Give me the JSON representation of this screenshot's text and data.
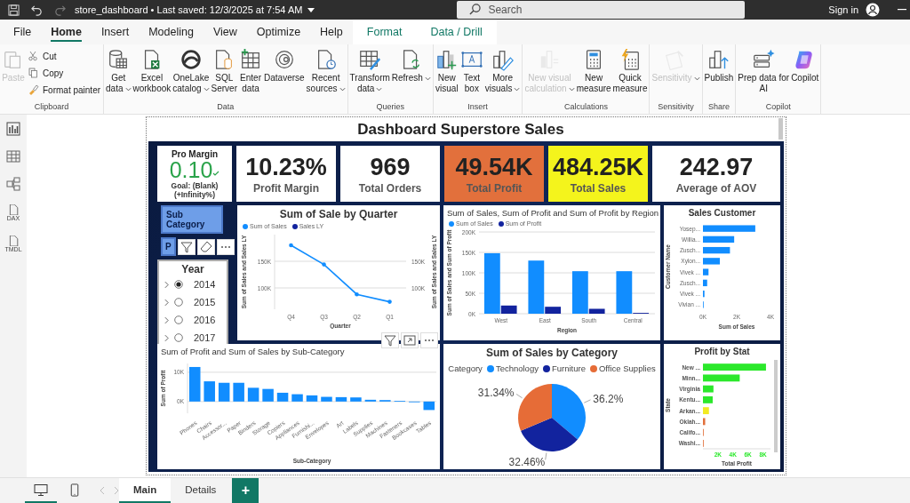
{
  "title_bar": {
    "title": "store_dashboard • Last saved: 12/3/2025 at 7:54 AM",
    "search_placeholder": "Search",
    "sign_in": "Sign in"
  },
  "menu_tabs": [
    {
      "label": "File",
      "selected": false,
      "kind": "standard"
    },
    {
      "label": "Home",
      "selected": true,
      "kind": "standard"
    },
    {
      "label": "Insert",
      "selected": false,
      "kind": "standard"
    },
    {
      "label": "Modeling",
      "selected": false,
      "kind": "standard"
    },
    {
      "label": "View",
      "selected": false,
      "kind": "standard"
    },
    {
      "label": "Optimize",
      "selected": false,
      "kind": "standard"
    },
    {
      "label": "Help",
      "selected": false,
      "kind": "standard"
    },
    {
      "label": "Format",
      "selected": false,
      "kind": "contextual"
    },
    {
      "label": "Data / Drill",
      "selected": false,
      "kind": "contextual"
    }
  ],
  "ribbon": {
    "groups": [
      {
        "label": "Clipboard",
        "buttons": [
          {
            "kind": "large",
            "lines": [
              "Paste"
            ],
            "disabled": true,
            "dropdown": false
          },
          {
            "kind": "small",
            "lines": [
              "Cut"
            ],
            "disabled": false,
            "dropdown": false
          },
          {
            "kind": "small",
            "lines": [
              "Copy"
            ],
            "disabled": false,
            "dropdown": false
          },
          {
            "kind": "small",
            "lines": [
              "Format painter"
            ],
            "disabled": false,
            "dropdown": false
          }
        ]
      },
      {
        "label": "Data",
        "buttons": [
          {
            "kind": "large",
            "lines": [
              "Get",
              "data"
            ],
            "disabled": false,
            "dropdown": true
          },
          {
            "kind": "large",
            "lines": [
              "Excel",
              "workbook"
            ],
            "disabled": false,
            "dropdown": false
          },
          {
            "kind": "large",
            "lines": [
              "OneLake",
              "catalog"
            ],
            "disabled": false,
            "dropdown": true
          },
          {
            "kind": "large",
            "lines": [
              "SQL",
              "Server"
            ],
            "disabled": false,
            "dropdown": false
          },
          {
            "kind": "large",
            "lines": [
              "Enter",
              "data"
            ],
            "disabled": false,
            "dropdown": false
          },
          {
            "kind": "large",
            "lines": [
              "Dataverse"
            ],
            "disabled": false,
            "dropdown": false
          },
          {
            "kind": "large",
            "lines": [
              "Recent",
              "sources"
            ],
            "disabled": false,
            "dropdown": true
          }
        ]
      },
      {
        "label": "Queries",
        "buttons": [
          {
            "kind": "large",
            "lines": [
              "Transform",
              "data"
            ],
            "disabled": false,
            "dropdown": true
          },
          {
            "kind": "large",
            "lines": [
              "Refresh"
            ],
            "disabled": false,
            "dropdown": true
          }
        ]
      },
      {
        "label": "Insert",
        "buttons": [
          {
            "kind": "large",
            "lines": [
              "New",
              "visual"
            ],
            "disabled": false,
            "dropdown": false
          },
          {
            "kind": "large",
            "lines": [
              "Text",
              "box"
            ],
            "disabled": false,
            "dropdown": false
          },
          {
            "kind": "large",
            "lines": [
              "More",
              "visuals"
            ],
            "disabled": false,
            "dropdown": true
          }
        ]
      },
      {
        "label": "Calculations",
        "buttons": [
          {
            "kind": "large",
            "lines": [
              "New visual",
              "calculation"
            ],
            "disabled": true,
            "dropdown": true
          },
          {
            "kind": "large",
            "lines": [
              "New",
              "measure"
            ],
            "disabled": false,
            "dropdown": false
          },
          {
            "kind": "large",
            "lines": [
              "Quick",
              "measure"
            ],
            "disabled": false,
            "dropdown": false
          }
        ]
      },
      {
        "label": "Sensitivity",
        "buttons": [
          {
            "kind": "large",
            "lines": [
              "Sensitivity"
            ],
            "disabled": true,
            "dropdown": true
          }
        ]
      },
      {
        "label": "Share",
        "buttons": [
          {
            "kind": "large",
            "lines": [
              "Publish"
            ],
            "disabled": false,
            "dropdown": false
          }
        ]
      },
      {
        "label": "Copilot",
        "buttons": [
          {
            "kind": "large",
            "lines": [
              "Prep data for",
              "AI"
            ],
            "disabled": false,
            "dropdown": false
          },
          {
            "kind": "large",
            "lines": [
              "Copilot"
            ],
            "disabled": false,
            "dropdown": false
          }
        ]
      }
    ]
  },
  "side_rail": [
    {
      "kind": "report"
    },
    {
      "kind": "table"
    },
    {
      "kind": "model"
    },
    {
      "kind": "dax",
      "label": "DAX"
    },
    {
      "kind": "tmdl",
      "label": "TMDL"
    }
  ],
  "report": {
    "title": "Dashboard Superstore Sales",
    "goal_card": {
      "title": "Pro Margin",
      "value": "0.10",
      "goal": "Goal: (Blank)",
      "change": "(+Infinity%)"
    },
    "kpi_cards": [
      {
        "value": "10.23%",
        "label": "Profit Margin",
        "color": "#ffffff"
      },
      {
        "value": "969",
        "label": "Total Orders",
        "color": "#ffffff"
      },
      {
        "value": "49.54K",
        "label": "Total Profit",
        "color": "#e2703c"
      },
      {
        "value": "484.25K",
        "label": "Total Sales",
        "color": "#f4f41c"
      },
      {
        "value": "242.97",
        "label": "Average of AOV",
        "color": "#ffffff"
      }
    ],
    "buttons": [
      {
        "label": "Sub Category"
      },
      {
        "label": "P"
      }
    ],
    "year_slicer": {
      "title": "Year",
      "items": [
        {
          "label": "2014",
          "selected": true
        },
        {
          "label": "2015",
          "selected": false
        },
        {
          "label": "2016",
          "selected": false
        },
        {
          "label": "2017",
          "selected": false
        }
      ]
    },
    "line_chart": {
      "chart_data": {
        "type": "line",
        "title": "Sum of Sale by Quarter",
        "xlabel": "Quarter",
        "ylabel": "Sum of Sales and Sales LY",
        "y2label": "Sum of Sales and Sales LY",
        "categories": [
          "Q4",
          "Q3",
          "Q2",
          "Q1"
        ],
        "ylim": [
          60000,
          200000
        ],
        "grid": true,
        "legend": "top",
        "yticks": [
          {
            "value": 100000,
            "label": "100K"
          },
          {
            "value": 150000,
            "label": "150K"
          }
        ],
        "series": [
          {
            "name": "Sum of Sales",
            "color": "#118dff",
            "values": [
              180000,
              144000,
              88000,
              74000
            ]
          },
          {
            "name": "Sales LY",
            "color": "#12239e",
            "values": [
              null,
              null,
              null,
              null
            ]
          }
        ]
      }
    },
    "region_chart": {
      "chart_data": {
        "type": "bar",
        "title": "Sum of Sales, Sum of Profit and Sum of Profit by Region",
        "xlabel": "Region",
        "ylabel": "Sum of Sales and Sum of Profit",
        "categories": [
          "West",
          "East",
          "South",
          "Central"
        ],
        "ylim": [
          0,
          200000
        ],
        "grid": true,
        "legend": "top",
        "yticks": [
          {
            "value": 0,
            "label": "0K"
          },
          {
            "value": 50000,
            "label": "50K"
          },
          {
            "value": 100000,
            "label": "100K"
          },
          {
            "value": 150000,
            "label": "150K"
          },
          {
            "value": 200000,
            "label": "200K"
          }
        ],
        "series": [
          {
            "name": "Sum of Sales",
            "color": "#118dff",
            "values": [
              148000,
              130000,
              104000,
              104000
            ]
          },
          {
            "name": "Sum of Profit",
            "color": "#12239e",
            "values": [
              20000,
              17000,
              12000,
              2000
            ]
          }
        ]
      }
    },
    "customer_chart": {
      "chart_data": {
        "type": "bar",
        "orientation": "horizontal",
        "title": "Sales Customer",
        "xlabel": "Sum of Sales",
        "ylabel": "Customer Name",
        "categories": [
          "Yosep...",
          "Willia...",
          "Zusch...",
          "Xylon...",
          "Vivek ...",
          "Zusch...",
          "Vivek ...",
          "Vivian ..."
        ],
        "xlim": [
          0,
          4000
        ],
        "xticks": [
          {
            "value": 0,
            "label": "0K"
          },
          {
            "value": 2000,
            "label": "2K"
          },
          {
            "value": 4000,
            "label": "4K"
          }
        ],
        "series": [
          {
            "color": "#118dff",
            "values": [
              3100,
              1850,
              1600,
              1000,
              330,
              250,
              90,
              20
            ]
          }
        ]
      }
    },
    "subcategory_chart": {
      "chart_data": {
        "type": "bar",
        "title": "Sum of Profit and Sum of Sales by Sub-Category",
        "xlabel": "Sub-Category",
        "ylabel": "Sum of Profit",
        "categories": [
          "Phones",
          "Chairs",
          "Accessor...",
          "Paper",
          "Binders",
          "Storage",
          "Copiers",
          "Appliances",
          "Furnishi...",
          "Envelopes",
          "Art",
          "Labels",
          "Supplies",
          "Machines",
          "Fasteners",
          "Bookcases",
          "Tables"
        ],
        "ylim": [
          -4000,
          13000
        ],
        "grid": true,
        "yticks": [
          {
            "value": 0,
            "label": "0K"
          },
          {
            "value": 10000,
            "label": "10K"
          }
        ],
        "series": [
          {
            "color": "#118dff",
            "values": [
              11800,
              6900,
              6400,
              6400,
              4700,
              4300,
              3000,
              2500,
              2100,
              1600,
              1500,
              1400,
              600,
              500,
              200,
              -200,
              -2900
            ]
          }
        ]
      }
    },
    "category_chart": {
      "chart_data": {
        "type": "pie",
        "title": "Sum of Sales by Category",
        "legend_title": "Category",
        "categories": [
          "Technology",
          "Furniture",
          "Office Supplies"
        ],
        "legend": "top",
        "series": [
          {
            "values": [
              36.2,
              32.46,
              31.34
            ],
            "colors": [
              "#118dff",
              "#12239e",
              "#e66c37"
            ]
          }
        ],
        "value_labels": [
          "36.2%",
          "32.46%",
          "31.34%"
        ]
      }
    },
    "state_chart": {
      "chart_data": {
        "type": "bar",
        "orientation": "horizontal",
        "title": "Profit by Stat",
        "xlabel": "Total Profit",
        "ylabel": "State",
        "categories": [
          "New ...",
          "Minn...",
          "Virginia",
          "Kentu...",
          "Arkan...",
          "Oklah...",
          "Califo...",
          "Washi..."
        ],
        "xlim": [
          0,
          9000
        ],
        "xticks": [
          {
            "value": 2000,
            "label": "2K"
          },
          {
            "value": 4000,
            "label": "4K"
          },
          {
            "value": 6000,
            "label": "6K"
          },
          {
            "value": 8000,
            "label": "8K"
          }
        ],
        "series": [
          {
            "values": [
              8400,
              4900,
              1400,
              1300,
              800,
              300,
              100,
              100
            ],
            "colors": [
              "#2be82b",
              "#2be82b",
              "#2be82b",
              "#2be82b",
              "#f2ea22",
              "#e2703c",
              "#e2703c",
              "#e2703c"
            ]
          }
        ]
      }
    }
  },
  "view_modes": [
    {
      "kind": "desktop",
      "selected": true
    },
    {
      "kind": "mobile",
      "selected": false
    }
  ],
  "page_tabs": [
    {
      "label": "Main",
      "selected": true
    },
    {
      "label": "Details",
      "selected": false
    }
  ],
  "add_page": "+"
}
